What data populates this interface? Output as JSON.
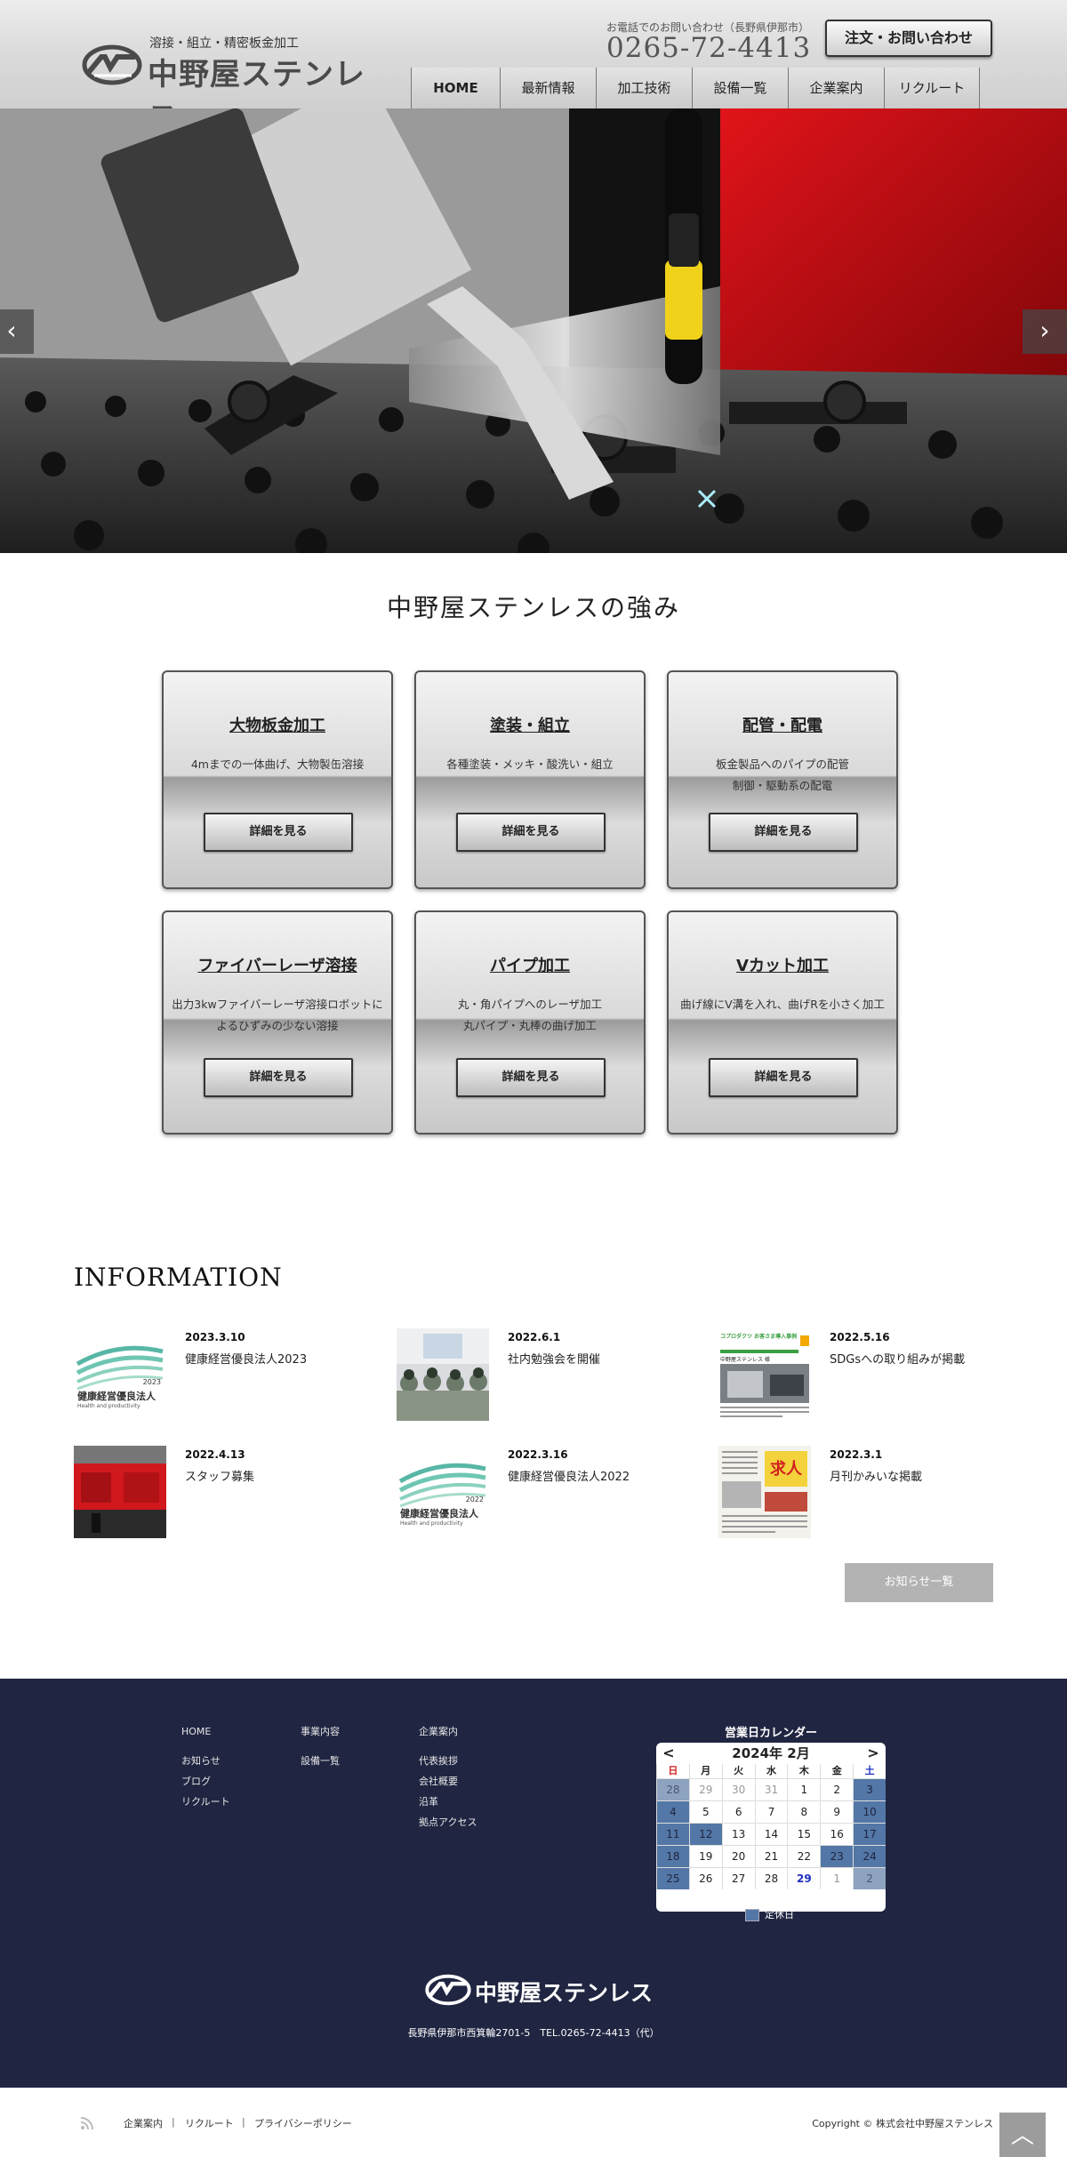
{
  "header": {
    "tagline": "溶接・組立・精密板金加工",
    "company_name": "中野屋ステンレス",
    "tel_label": "お電話でのお問い合わせ（長野県伊那市）",
    "tel_number": "0265-72-4413",
    "contact_button": "注文・お問い合わせ"
  },
  "nav": [
    "HOME",
    "最新情報",
    "加工技術",
    "設備一覧",
    "企業案内",
    "リクルート"
  ],
  "hero": {
    "prev": "‹",
    "next": "›"
  },
  "strengths": {
    "title": "中野屋ステンレスの強み",
    "cards": [
      {
        "title": "大物板金加工",
        "desc": "4mまでの一体曲げ、大物製缶溶接",
        "button": "詳細を見る"
      },
      {
        "title": "塗装・組立",
        "desc": "各種塗装・メッキ・酸洗い・組立",
        "button": "詳細を見る"
      },
      {
        "title": "配管・配電",
        "desc": "板金製品へのパイプの配管\n制御・駆動系の配電",
        "button": "詳細を見る"
      },
      {
        "title": "ファイバーレーザ溶接",
        "desc": "出力3kwファイバーレーザ溶接ロボットによるひずみの少ない溶接",
        "button": "詳細を見る"
      },
      {
        "title": "パイプ加工",
        "desc": "丸・角パイプへのレーザ加工\n丸パイプ・丸棒の曲げ加工",
        "button": "詳細を見る"
      },
      {
        "title": "Vカット加工",
        "desc": "曲げ線にV溝を入れ、曲げRを小さく加工",
        "button": "詳細を見る"
      }
    ]
  },
  "information": {
    "title": "INFORMATION",
    "items": [
      {
        "date": "2023.3.10",
        "title": "健康経営優良法人2023",
        "thumb": "health-2023"
      },
      {
        "date": "2022.6.1",
        "title": "社内勉強会を開催",
        "thumb": "seminar-photo"
      },
      {
        "date": "2022.5.16",
        "title": "SDGsへの取り組みが掲載",
        "thumb": "sdgs-article"
      },
      {
        "date": "2022.4.13",
        "title": "スタッフ募集",
        "thumb": "factory-photo"
      },
      {
        "date": "2022.3.16",
        "title": "健康経営優良法人2022",
        "thumb": "health-2022"
      },
      {
        "date": "2022.3.1",
        "title": "月刊かみいな掲載",
        "thumb": "magazine-article"
      }
    ],
    "logo_text": "健康経営優良法人",
    "logo_sub": "Health and productivity",
    "logo_year_2023": "2023",
    "logo_year_2022": "2022",
    "article_head": "コプロダクツ お客さま導入事例",
    "article_sub": "中野屋ステンレス 様",
    "magazine_head": "求人",
    "more_button": "お知らせ一覧"
  },
  "footer": {
    "col1": {
      "head": "HOME",
      "items": [
        "お知らせ",
        "ブログ",
        "リクルート"
      ]
    },
    "col2": {
      "head": "事業内容",
      "items": [
        "設備一覧"
      ]
    },
    "col3": {
      "head": "企業案内",
      "items": [
        "代表挨拶",
        "会社概要",
        "沿革",
        "拠点アクセス"
      ]
    },
    "calendar": {
      "title": "営業日カレンダー",
      "month": "2024年 2月",
      "prev": "<",
      "next": ">",
      "weekdays": [
        "日",
        "月",
        "火",
        "水",
        "木",
        "金",
        "土"
      ],
      "weekday_colors": {
        "sun": "#d12020",
        "sat": "#1d2fbf"
      },
      "weeks": [
        [
          "28",
          "29",
          "30",
          "31",
          "1",
          "2",
          "3"
        ],
        [
          "4",
          "5",
          "6",
          "7",
          "8",
          "9",
          "10"
        ],
        [
          "11",
          "12",
          "13",
          "14",
          "15",
          "16",
          "17"
        ],
        [
          "18",
          "19",
          "20",
          "21",
          "22",
          "23",
          "24"
        ],
        [
          "25",
          "26",
          "27",
          "28",
          "29",
          "1",
          "2"
        ]
      ],
      "holiday_color": "#5377a6",
      "legend": "定休日"
    },
    "address": "長野県伊那市西箕輪2701-5　TEL.0265-72-4413（代）"
  },
  "bottom": {
    "links": [
      "企業案内",
      "リクルート",
      "プライバシーポリシー"
    ],
    "separator": "|",
    "copyright": "Copyright ©  株式会社中野屋ステンレス",
    "pagetop": "︿"
  }
}
